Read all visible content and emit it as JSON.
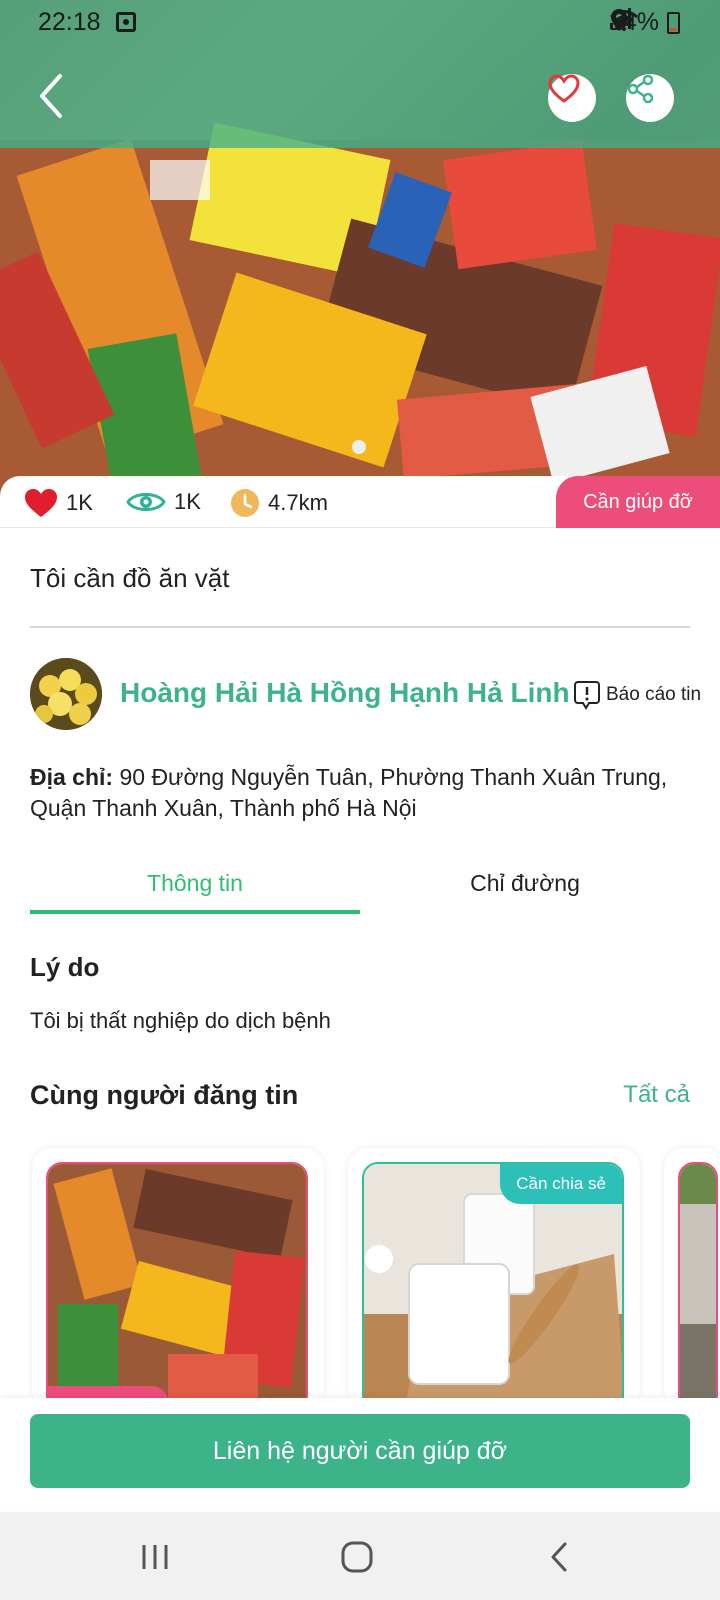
{
  "status_bar": {
    "time": "22:18",
    "battery": "14%"
  },
  "stats": {
    "likes": "1K",
    "views": "1K",
    "distance": "4.7km"
  },
  "status_tag": "Cần giúp đỡ",
  "post": {
    "title": "Tôi cần đồ ăn vặt"
  },
  "author": {
    "name": "Hoàng Hải Hà Hồng Hạnh Hả Linh",
    "report_label": "Báo cáo tin"
  },
  "address": {
    "label": "Địa chỉ:",
    "value": " 90 Đường Nguyễn Tuân, Phường Thanh Xuân Trung, Quận Thanh Xuân, Thành phố Hà Nội"
  },
  "tabs": [
    {
      "label": "Thông tin",
      "active": true
    },
    {
      "label": "Chỉ đường",
      "active": false
    }
  ],
  "reason": {
    "title": "Lý do",
    "text": "Tôi bị thất nghiệp do dịch bệnh"
  },
  "same_poster": {
    "title": "Cùng người đăng tin",
    "see_all": "Tất cả"
  },
  "related_cards": [
    {
      "badge": ""
    },
    {
      "badge": "Cần chia sẻ"
    },
    {
      "badge": ""
    }
  ],
  "contact_button": "Liên hệ người cần giúp đỡ",
  "colors": {
    "accent": "#3db38a",
    "tab_active": "#2fbe6e",
    "help_tag": "#ec4d7a",
    "share_tag": "#2cc0b8"
  }
}
